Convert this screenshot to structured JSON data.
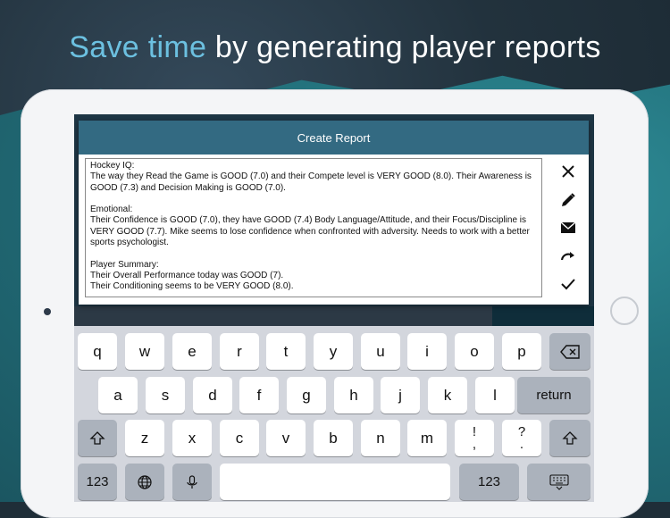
{
  "headline": {
    "accent": "Save time",
    "rest": " by generating player reports"
  },
  "dialog": {
    "title": "Create Report",
    "paragraphs": [
      "Hockey IQ:\nThe way they Read the Game is GOOD (7.0) and their Compete level is VERY GOOD (8.0). Their Awareness is GOOD (7.3) and Decision Making is GOOD (7.0).\n",
      "Emotional:\nTheir Confidence is GOOD (7.0), they have GOOD (7.4) Body Language/Attitude, and their Focus/Discipline is VERY GOOD (7.7). Mike seems to lose confidence when confronted with adversity. Needs to work with a better sports psychologist.",
      "Player Summary:\nTheir Overall Performance today was GOOD (7).\nTheir Conditioning seems to be VERY GOOD (8.0)."
    ],
    "actions": [
      "close-icon",
      "pencil-icon",
      "envelope-icon",
      "redo-icon",
      "checkmark-icon"
    ]
  },
  "keyboard": {
    "row1": [
      "q",
      "w",
      "e",
      "r",
      "t",
      "y",
      "u",
      "i",
      "o",
      "p"
    ],
    "row2": [
      "a",
      "s",
      "d",
      "f",
      "g",
      "h",
      "j",
      "k",
      "l"
    ],
    "row3": [
      "z",
      "x",
      "c",
      "v",
      "b",
      "n",
      "m"
    ],
    "punct1": {
      "top": "!",
      "bottom": ","
    },
    "punct2": {
      "top": "?",
      "bottom": "."
    },
    "return_label": "return",
    "numbers_label": "123",
    "numbers_label_right": "123"
  }
}
